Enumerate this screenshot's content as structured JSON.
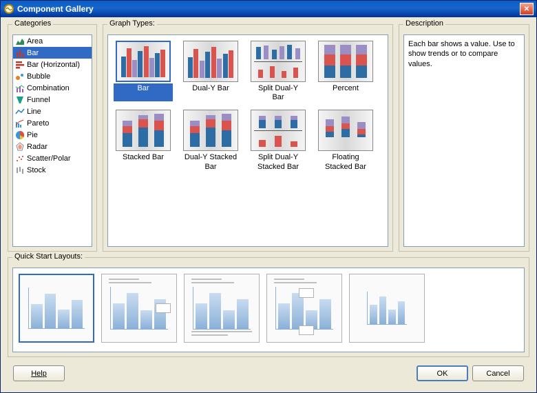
{
  "window": {
    "title": "Component Gallery"
  },
  "panels": {
    "categories": "Categories",
    "types": "Graph Types:",
    "description": "Description",
    "layouts": "Quick Start Layouts:"
  },
  "categories": [
    {
      "label": "Area",
      "icon": "area"
    },
    {
      "label": "Bar",
      "icon": "bar"
    },
    {
      "label": "Bar (Horizontal)",
      "icon": "hbar"
    },
    {
      "label": "Bubble",
      "icon": "bubble"
    },
    {
      "label": "Combination",
      "icon": "combo"
    },
    {
      "label": "Funnel",
      "icon": "funnel"
    },
    {
      "label": "Line",
      "icon": "line"
    },
    {
      "label": "Pareto",
      "icon": "pareto"
    },
    {
      "label": "Pie",
      "icon": "pie"
    },
    {
      "label": "Radar",
      "icon": "radar"
    },
    {
      "label": "Scatter/Polar",
      "icon": "scatter"
    },
    {
      "label": "Stock",
      "icon": "stock"
    }
  ],
  "selected_category": 1,
  "graph_types": [
    {
      "label": "Bar",
      "variant": "bar"
    },
    {
      "label": "Dual-Y Bar",
      "variant": "dualy"
    },
    {
      "label": "Split Dual-Y Bar",
      "variant": "splitdualy"
    },
    {
      "label": "Percent",
      "variant": "percent"
    },
    {
      "label": "Stacked Bar",
      "variant": "stacked"
    },
    {
      "label": "Dual-Y Stacked Bar",
      "variant": "dualystacked"
    },
    {
      "label": "Split Dual-Y Stacked Bar",
      "variant": "splitdualystacked"
    },
    {
      "label": "Floating Stacked Bar",
      "variant": "floating"
    }
  ],
  "selected_type": 0,
  "description_text": "Each bar shows a value. Use to show trends or to compare values.",
  "layouts_count": 5,
  "selected_layout": 0,
  "buttons": {
    "help": "Help",
    "ok": "OK",
    "cancel": "Cancel"
  }
}
